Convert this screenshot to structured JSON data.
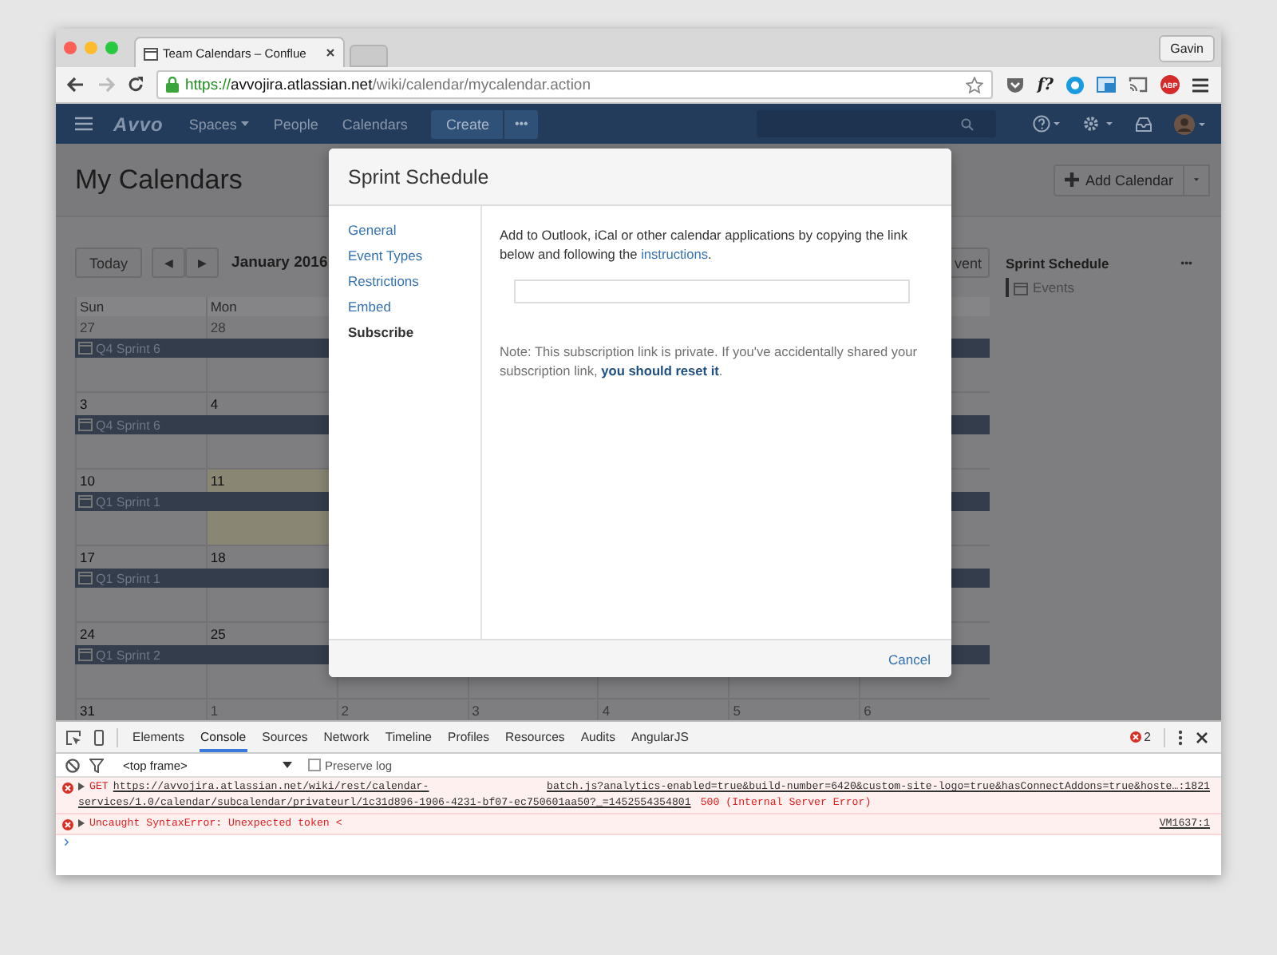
{
  "browser": {
    "tab": {
      "title": "Team Calendars – Conflue"
    },
    "profile": "Gavin",
    "url": {
      "scheme": "https://",
      "host": "avvojira.atlassian.net",
      "path": "/wiki/calendar/mycalendar.action"
    },
    "extension_label": "f?",
    "adblock_label": "ABP"
  },
  "nav": {
    "logo": "Avvo",
    "items": [
      {
        "label": "Spaces",
        "dropdown": true
      },
      {
        "label": "People",
        "dropdown": false
      },
      {
        "label": "Calendars",
        "dropdown": false
      }
    ],
    "create": "Create",
    "more": "•••"
  },
  "page": {
    "title": "My Calendars",
    "add_calendar": "Add Calendar",
    "today": "Today",
    "prev": "◀",
    "next": "▶",
    "month": "January 2016",
    "add_event": "vent",
    "weekdays": [
      "Sun",
      "Mon"
    ],
    "weeks": [
      {
        "days": [
          {
            "date": "27",
            "muted": true,
            "today": false
          },
          {
            "date": "28",
            "muted": true,
            "today": false
          }
        ],
        "event": "Q4 Sprint 6"
      },
      {
        "days": [
          {
            "date": "3",
            "muted": false,
            "today": false
          },
          {
            "date": "4",
            "muted": false,
            "today": false
          }
        ],
        "event": "Q4 Sprint 6"
      },
      {
        "days": [
          {
            "date": "10",
            "muted": false,
            "today": false
          },
          {
            "date": "11",
            "muted": false,
            "today": true
          }
        ],
        "event": "Q1 Sprint 1"
      },
      {
        "days": [
          {
            "date": "17",
            "muted": false,
            "today": false
          },
          {
            "date": "18",
            "muted": false,
            "today": false
          }
        ],
        "event": "Q1 Sprint 1"
      },
      {
        "days": [
          {
            "date": "24",
            "muted": false,
            "today": false
          },
          {
            "date": "25",
            "muted": false,
            "today": false
          }
        ],
        "event": "Q1 Sprint 2"
      },
      {
        "days": [
          {
            "date": "31",
            "muted": false,
            "today": false
          },
          {
            "date": "1",
            "muted": true,
            "today": false
          },
          {
            "date": "2",
            "muted": true,
            "today": false
          },
          {
            "date": "3",
            "muted": true,
            "today": false
          },
          {
            "date": "4",
            "muted": true,
            "today": false
          },
          {
            "date": "5",
            "muted": true,
            "today": false
          },
          {
            "date": "6",
            "muted": true,
            "today": false
          }
        ]
      }
    ],
    "sidebar": {
      "calendar": "Sprint Schedule",
      "more": "•••",
      "subcalendar": "Events"
    }
  },
  "dialog": {
    "title": "Sprint Schedule",
    "menu": [
      {
        "label": "General",
        "selected": false
      },
      {
        "label": "Event Types",
        "selected": false
      },
      {
        "label": "Restrictions",
        "selected": false
      },
      {
        "label": "Embed",
        "selected": false
      },
      {
        "label": "Subscribe",
        "selected": true
      }
    ],
    "intro": {
      "text": "Add to Outlook, iCal or other calendar applications by copying the link below and following the",
      "link": "instructions",
      "after": "."
    },
    "note": {
      "text": "Note: This subscription link is private. If you've accidentally shared your subscription link,",
      "link": "you should reset it",
      "after": "."
    },
    "cancel": "Cancel"
  },
  "devtools": {
    "tabs": [
      {
        "label": "Elements",
        "selected": false
      },
      {
        "label": "Console",
        "selected": true
      },
      {
        "label": "Sources",
        "selected": false
      },
      {
        "label": "Network",
        "selected": false
      },
      {
        "label": "Timeline",
        "selected": false
      },
      {
        "label": "Profiles",
        "selected": false
      },
      {
        "label": "Resources",
        "selected": false
      },
      {
        "label": "Audits",
        "selected": false
      },
      {
        "label": "AngularJS",
        "selected": false
      }
    ],
    "error_count": "2",
    "frame": "<top frame>",
    "preserve_log": {
      "label": "Preserve log",
      "checked": false
    },
    "messages": [
      {
        "method": "GET",
        "url": "https://avvojira.atlassian.net/wiki/rest/calendar-",
        "url_cont": "services/1.0/calendar/subcalendar/privateurl/1c31d896-1906-4231-bf07-ec750601aa50?_=1452554354801",
        "status": "500 (Internal Server Error)",
        "source": "batch.js?analytics-enabled=true&build-number=6420&custom-site-logo=true&hasConnectAddons=true&hoste…:1821"
      },
      {
        "text": "Uncaught SyntaxError: Unexpected token <",
        "source": "VM1637:1"
      }
    ],
    "prompt": "›"
  }
}
